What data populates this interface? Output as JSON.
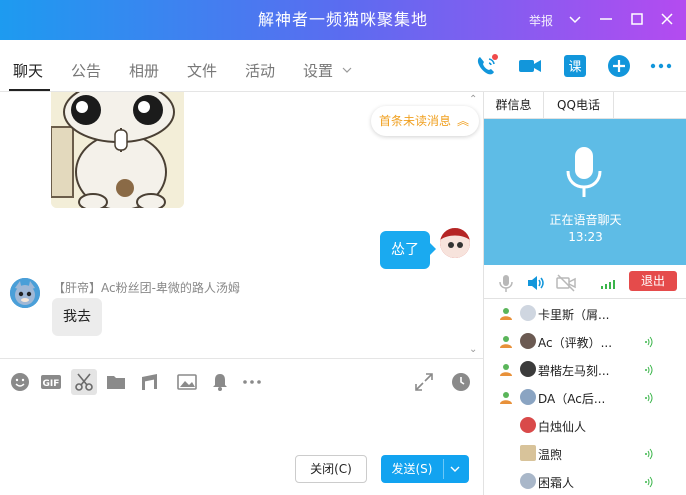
{
  "window": {
    "title": "解神者一频猫咪聚集地",
    "report": "举报",
    "gradient": [
      "#1d9bf0",
      "#5b6cf0",
      "#b44bf0"
    ]
  },
  "tabs": [
    {
      "label": "聊天",
      "active": true
    },
    {
      "label": "公告"
    },
    {
      "label": "相册"
    },
    {
      "label": "文件"
    },
    {
      "label": "活动"
    },
    {
      "label": "设置"
    }
  ],
  "chat": {
    "unread_label": "首条未读消息",
    "messages": [
      {
        "from": "me",
        "text": "怂了"
      },
      {
        "from": "them",
        "sender": "【肝帝】Ac粉丝团-卑微的路人汤姆",
        "text": "我去"
      }
    ]
  },
  "input": {
    "close_label": "关闭(C)",
    "send_label": "发送(S)"
  },
  "side": {
    "tabs": [
      "群信息",
      "QQ电话"
    ],
    "voice_status": "正在语音聊天",
    "voice_time": "13:23",
    "exit_label": "退出",
    "members": [
      {
        "name": "卡里斯（屑..."
      },
      {
        "name": "Ac（评教）..."
      },
      {
        "name": "碧楷左马刻..."
      },
      {
        "name": "DA（Ac后..."
      },
      {
        "name": "白烛仙人"
      },
      {
        "name": "温煦"
      },
      {
        "name": "困霜人"
      }
    ]
  },
  "colors": {
    "accent": "#12a3f0",
    "voice_bg": "#5ebce6",
    "exit": "#e54b4b",
    "unread": "#f0a020"
  }
}
